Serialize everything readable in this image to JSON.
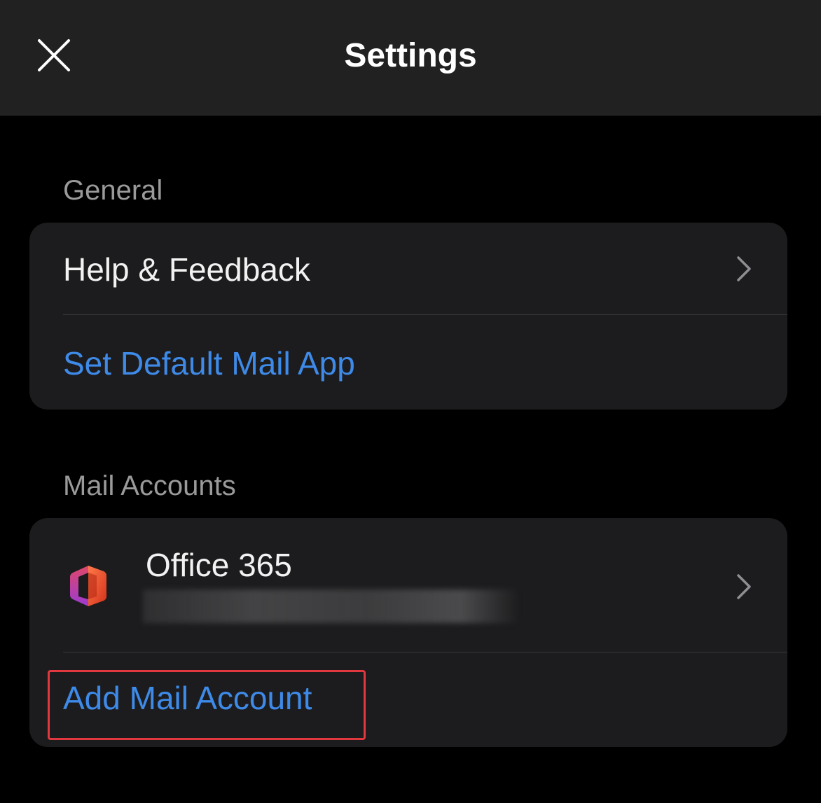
{
  "header": {
    "title": "Settings",
    "close_icon": "close-icon"
  },
  "general": {
    "section_label": "General",
    "items": [
      {
        "label": "Help & Feedback",
        "icon": "chevron-right-icon"
      },
      {
        "label": "Set Default Mail App"
      }
    ]
  },
  "mail_accounts": {
    "section_label": "Mail Accounts",
    "account": {
      "name": "Office 365",
      "icon": "office-365-icon",
      "chevron": "chevron-right-icon"
    },
    "add_label": "Add Mail Account"
  },
  "colors": {
    "background": "#000000",
    "header": "#212121",
    "card": "#1c1c1e",
    "link_blue": "#3e8ae8",
    "highlight_red": "#e0383e",
    "section_label": "#9a9a9a"
  }
}
